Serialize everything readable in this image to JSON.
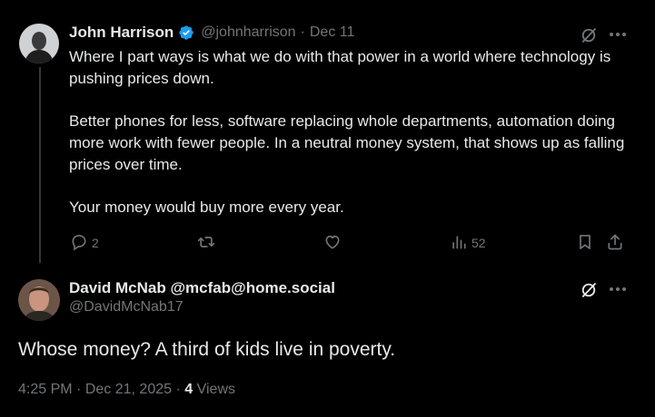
{
  "colors": {
    "background": "#000000",
    "text": "#e7e9ea",
    "muted": "#71767b",
    "verified": "#1d9bf0",
    "thread_line": "#333639"
  },
  "tweet": {
    "author_name": "John Harrison",
    "handle": "@johnharrison",
    "separator": "·",
    "date": "Dec 11",
    "verified_icon": "verified-badge-icon",
    "paragraphs": [
      "Where I part ways is what we do with that power in a world where technology is pushing prices down.",
      "Better phones for less, software replacing whole departments, automation doing more work with fewer people. In a neutral money system, that shows up as falling prices over time.",
      "Your money would buy more every year."
    ],
    "actions": {
      "reply_count": "2",
      "retweet_count": "",
      "like_count": "",
      "views_count": "52"
    }
  },
  "reply": {
    "author_name": "David McNab @mcfab@home.social",
    "handle": "@DavidMcNab17",
    "text": "Whose money? A third of kids live in poverty.",
    "time": "4:25 PM",
    "separator": "·",
    "date": "Dec 21, 2025",
    "separator2": "·",
    "views_count": "4",
    "views_label": "Views"
  }
}
